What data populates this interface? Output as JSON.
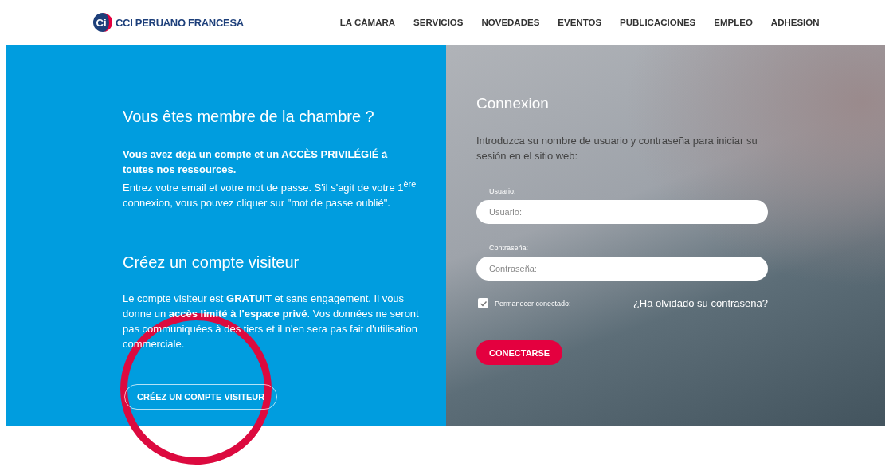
{
  "header": {
    "logo_mark": "Ci",
    "logo_text": "CCI PERUANO FRANCESA",
    "nav": [
      {
        "label": "LA CÁMARA"
      },
      {
        "label": "SERVICIOS"
      },
      {
        "label": "NOVEDADES"
      },
      {
        "label": "EVENTOS"
      },
      {
        "label": "PUBLICACIONES"
      },
      {
        "label": "EMPLEO"
      },
      {
        "label": "ADHESIÓN"
      }
    ]
  },
  "member": {
    "title": "Vous êtes membre de la chambre ?",
    "intro": "Vous avez déjà un compte et un ACCÈS PRIVILÉGIÉ à toutes nos ressources.",
    "note": "Entrez votre email et votre mot de passe. S'il s'agit de votre 1$^{ère}$ connexion, vous pouvez cliquer sur \"mot de passe oublié\".",
    "visitor_title": "Créez un compte visiteur",
    "visitor_text": "Le compte visiteur est **GRATUIT** et sans engagement. Il vous donne un **accès limité à l'espace privé**. Vos données ne seront pas communiquées à des tiers et il n'en sera pas fait d'utilisation commerciale.",
    "visitor_button": "CRÉEZ UN COMPTE VISITEUR"
  },
  "login": {
    "title": "Connexion",
    "intro": "Introduzca su nombre de usuario y contraseña para iniciar su sesión en el sitio web:",
    "fields": [
      {
        "label": "Usuario:",
        "placeholder": "Usuario:"
      },
      {
        "label": "Contraseña:",
        "placeholder": "Contraseña:"
      }
    ],
    "remember": {
      "label": "Permanecer conectado:",
      "checked": true
    },
    "forgot": "¿Ha olvidado su contraseña?",
    "submit": "CONECTARSE"
  }
}
